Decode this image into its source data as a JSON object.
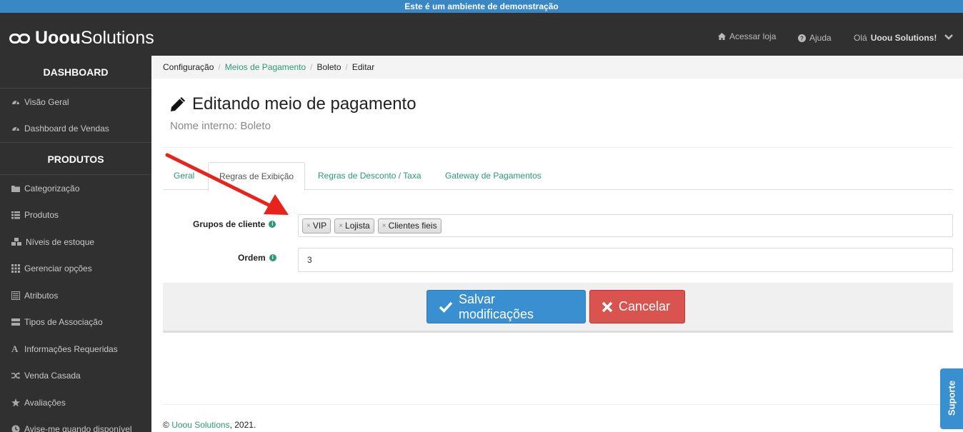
{
  "demo_banner": "Este é um ambiente de demonstração",
  "brand": {
    "bold": "Uoou",
    "light": "Solutions"
  },
  "topnav": {
    "store": "Acessar loja",
    "help": "Ajuda",
    "greeting": "Olá",
    "user": "Uoou Solutions!"
  },
  "sidebar": {
    "sections": [
      {
        "title": "DASHBOARD",
        "items": [
          "Visão Geral",
          "Dashboard de Vendas"
        ]
      },
      {
        "title": "PRODUTOS",
        "items": [
          "Categorização",
          "Produtos",
          "Níveis de estoque",
          "Gerenciar opções",
          "Atributos",
          "Tipos de Associação",
          "Informações Requeridas",
          "Venda Casada",
          "Avaliações",
          "Avise-me quando disponível"
        ]
      }
    ]
  },
  "breadcrumb": [
    "Configuração",
    "Meios de Pagamento",
    "Boleto",
    "Editar"
  ],
  "page": {
    "title": "Editando meio de pagamento",
    "subtitle": "Nome interno: Boleto"
  },
  "tabs": [
    "Geral",
    "Regras de Exibição",
    "Regras de Desconto / Taxa",
    "Gateway de Pagamentos"
  ],
  "form": {
    "groups_label": "Grupos de cliente",
    "groups": [
      "VIP",
      "Lojista",
      "Clientes fieis"
    ],
    "order_label": "Ordem",
    "order_value": "3"
  },
  "actions": {
    "save": "Salvar modificações",
    "cancel": "Cancelar"
  },
  "footer": {
    "copyright": "©",
    "company": "Uoou Solutions",
    "year": ", 2021."
  },
  "support": "Suporte",
  "colors": {
    "accent": "#2a9a7a",
    "primary": "#3a8fd1",
    "danger": "#d9534f",
    "dark": "#303030"
  }
}
